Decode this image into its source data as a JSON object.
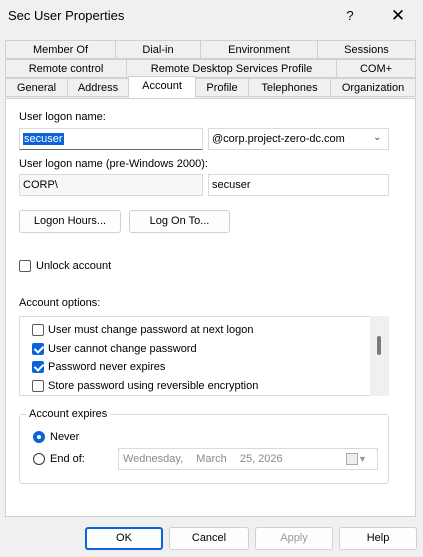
{
  "window": {
    "title": "Sec User Properties",
    "help_label": "?",
    "close_label": "✕"
  },
  "tabs": {
    "row1": [
      "Member Of",
      "Dial-in",
      "Environment",
      "Sessions"
    ],
    "row2": [
      "Remote control",
      "Remote Desktop Services Profile",
      "COM+"
    ],
    "row3": [
      "General",
      "Address",
      "Account",
      "Profile",
      "Telephones",
      "Organization"
    ],
    "selected": "Account"
  },
  "account": {
    "logon_name_label": "User logon name:",
    "logon_name_value": "secuser",
    "domain_value": "@corp.project-zero-dc.com",
    "pre2000_label": "User logon name (pre-Windows 2000):",
    "pre2000_domain": "CORP\\",
    "pre2000_user": "secuser",
    "logon_hours_button": "Logon Hours...",
    "log_on_to_button": "Log On To...",
    "unlock_label": "Unlock account",
    "unlock_checked": false,
    "account_options_label": "Account options:",
    "options": [
      {
        "label": "User must change password at next logon",
        "checked": false
      },
      {
        "label": "User cannot change password",
        "checked": true
      },
      {
        "label": "Password never expires",
        "checked": true
      },
      {
        "label": "Store password using reversible encryption",
        "checked": false
      }
    ],
    "account_expires_label": "Account expires",
    "never_label": "Never",
    "end_of_label": "End of:",
    "expires_selected": "Never",
    "date_weekday": "Wednesday,",
    "date_month": "March",
    "date_day_year": "25, 2026"
  },
  "buttons": {
    "ok": "OK",
    "cancel": "Cancel",
    "apply": "Apply",
    "help": "Help"
  },
  "colors": {
    "accent": "#0a64d8",
    "background": "#f0f0f0",
    "panel": "#ffffff"
  }
}
